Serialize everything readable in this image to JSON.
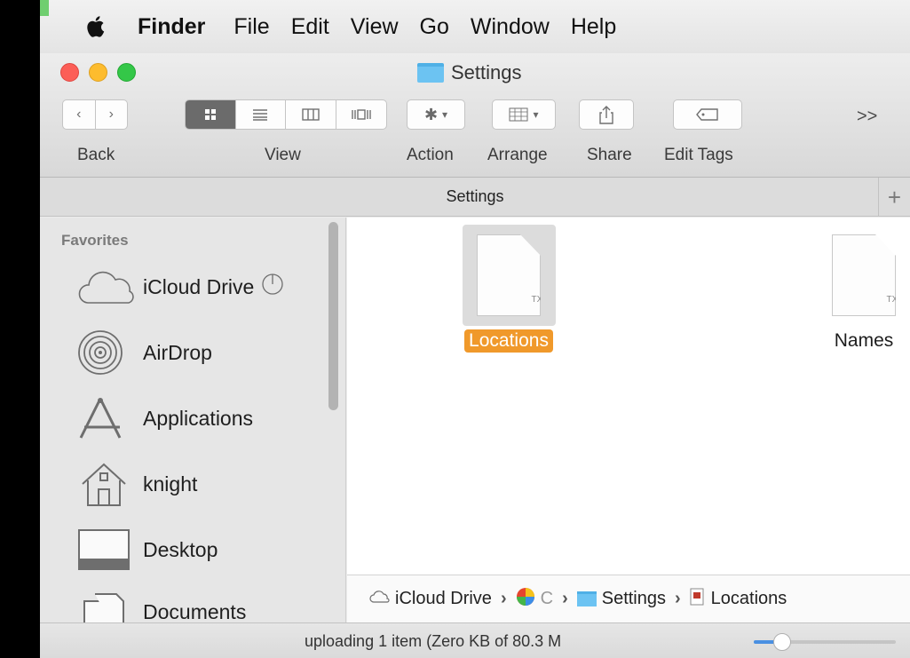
{
  "menubar": {
    "app_name": "Finder",
    "items": [
      "File",
      "Edit",
      "View",
      "Go",
      "Window",
      "Help"
    ]
  },
  "window": {
    "title": "Settings",
    "toolbar": {
      "back_label": "Back",
      "view_label": "View",
      "action_label": "Action",
      "arrange_label": "Arrange",
      "share_label": "Share",
      "edit_tags_label": "Edit Tags",
      "overflow": ">>"
    },
    "tab_title": "Settings",
    "tab_add": "+"
  },
  "sidebar": {
    "section": "Favorites",
    "items": [
      {
        "label": "iCloud Drive",
        "icon": "cloud-icon"
      },
      {
        "label": "AirDrop",
        "icon": "airdrop-icon"
      },
      {
        "label": "Applications",
        "icon": "applications-icon"
      },
      {
        "label": "knight",
        "icon": "home-icon"
      },
      {
        "label": "Desktop",
        "icon": "desktop-icon"
      },
      {
        "label": "Documents",
        "icon": "documents-icon"
      }
    ]
  },
  "files": [
    {
      "name": "Locations",
      "type": "TXT",
      "selected": true
    },
    {
      "name": "Names",
      "type": "TXT",
      "selected": false
    }
  ],
  "pathbar": {
    "items": [
      "iCloud Drive",
      "C",
      "Settings",
      "Locations"
    ]
  },
  "status": {
    "text": "uploading 1 item (Zero KB of 80.3 M",
    "zoom_fraction": 0.2
  },
  "colors": {
    "selection": "#f0992b",
    "folder": "#6cc3f2"
  }
}
